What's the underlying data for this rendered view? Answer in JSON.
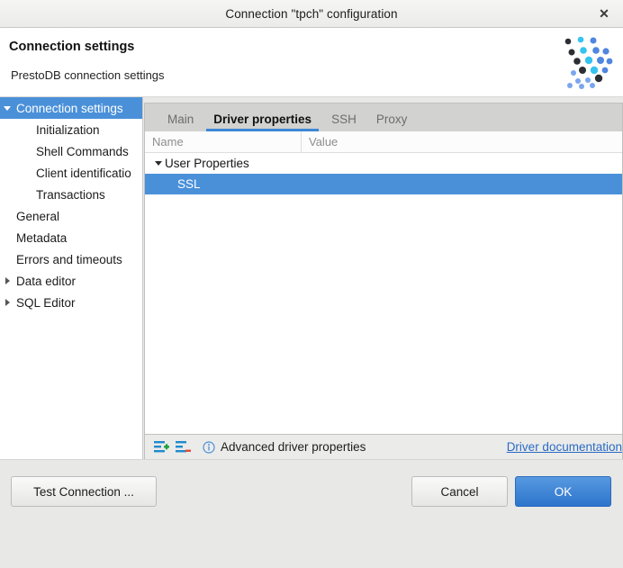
{
  "window": {
    "title": "Connection \"tpch\" configuration",
    "close_label": "✕"
  },
  "header": {
    "title": "Connection settings",
    "subtitle": "PrestoDB connection settings",
    "logo_name": "dbeaver-logo"
  },
  "sidebar": {
    "items": [
      {
        "label": "Connection settings",
        "level": 0,
        "twisty": "down",
        "selected": true
      },
      {
        "label": "Initialization",
        "level": 1,
        "twisty": "none",
        "selected": false
      },
      {
        "label": "Shell Commands",
        "level": 1,
        "twisty": "none",
        "selected": false
      },
      {
        "label": "Client identificatio",
        "level": 1,
        "twisty": "none",
        "selected": false
      },
      {
        "label": "Transactions",
        "level": 1,
        "twisty": "none",
        "selected": false
      },
      {
        "label": "General",
        "level": 0,
        "twisty": "none",
        "selected": false
      },
      {
        "label": "Metadata",
        "level": 0,
        "twisty": "none",
        "selected": false
      },
      {
        "label": "Errors and timeouts",
        "level": 0,
        "twisty": "none",
        "selected": false
      },
      {
        "label": "Data editor",
        "level": 0,
        "twisty": "right",
        "selected": false
      },
      {
        "label": "SQL Editor",
        "level": 0,
        "twisty": "right",
        "selected": false
      }
    ]
  },
  "panel": {
    "tabs": [
      {
        "label": "Main",
        "active": false
      },
      {
        "label": "Driver properties",
        "active": true
      },
      {
        "label": "SSH",
        "active": false
      },
      {
        "label": "Proxy",
        "active": false
      }
    ],
    "columns": {
      "name": "Name",
      "value": "Value"
    },
    "rows": [
      {
        "name": "User Properties",
        "value": "",
        "type": "group",
        "twisty": "down",
        "selected": false
      },
      {
        "name": "SSL",
        "value": "",
        "type": "item",
        "twisty": "none",
        "selected": true
      }
    ],
    "footer": {
      "add_icon": "add-property-icon",
      "remove_icon": "remove-property-icon",
      "info_icon": "info-icon",
      "info_text": "Advanced driver properties",
      "doc_link": "Driver documentation"
    }
  },
  "buttons": {
    "test": "Test Connection ...",
    "cancel": "Cancel",
    "ok": "OK"
  },
  "colors": {
    "accent": "#4a90d9",
    "tab_underline": "#3e87d4",
    "link": "#2a6bc4",
    "ok_button": "#2d75cc",
    "add_plus": "#19a03c",
    "remove_minus": "#e8452c",
    "list_bar": "#1e8bcd"
  }
}
